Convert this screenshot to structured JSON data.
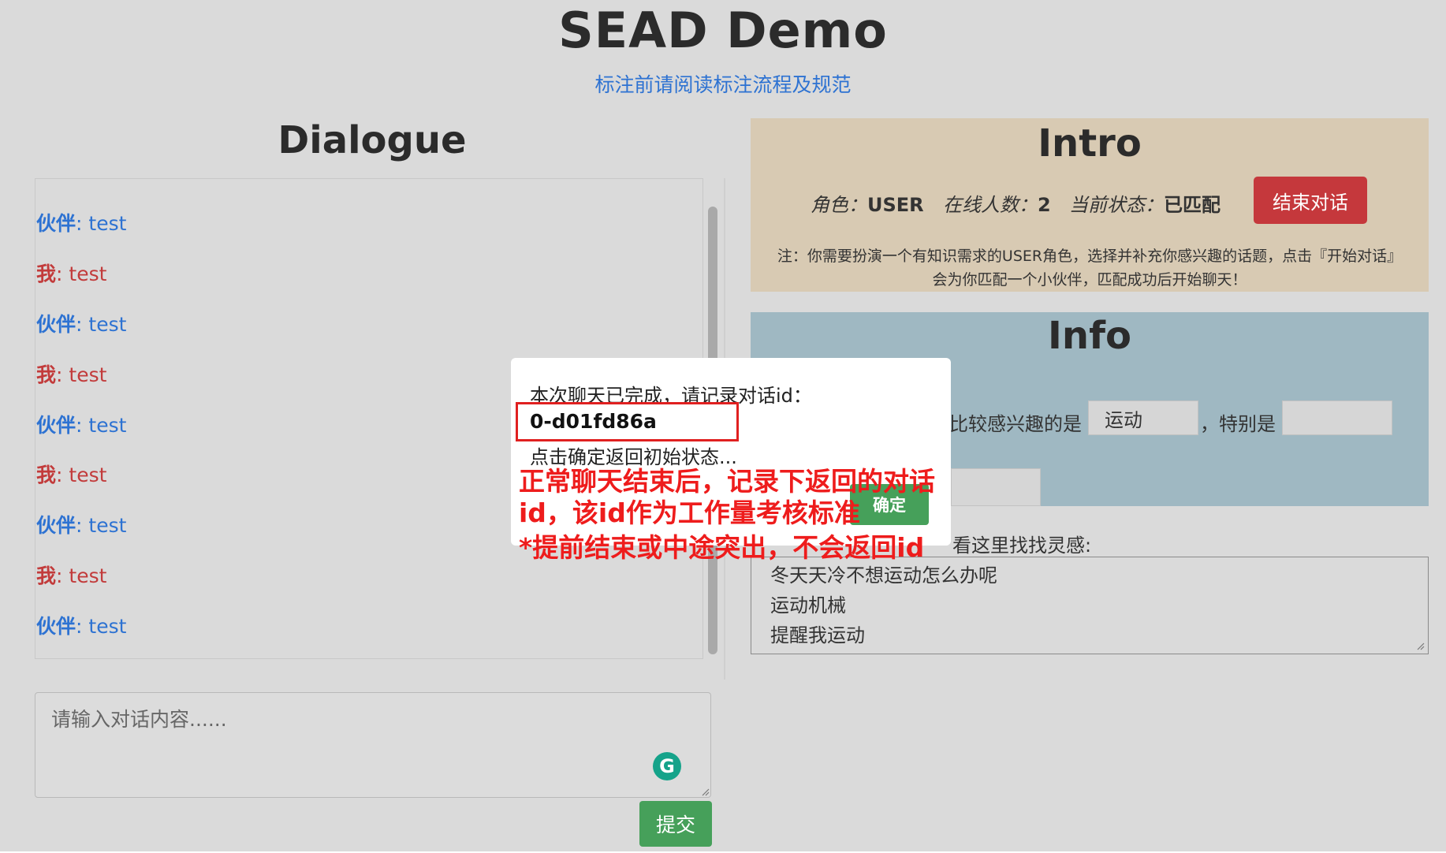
{
  "header": {
    "title": "SEAD Demo",
    "subtitle_link": "标注前请阅读标注流程及规范"
  },
  "dialogue": {
    "title": "Dialogue",
    "messages": [
      {
        "speaker": "伙伴",
        "text": ": test"
      },
      {
        "speaker": "我",
        "text": ": test"
      },
      {
        "speaker": "伙伴",
        "text": ": test"
      },
      {
        "speaker": "我",
        "text": ": test"
      },
      {
        "speaker": "伙伴",
        "text": ": test"
      },
      {
        "speaker": "我",
        "text": ": test"
      },
      {
        "speaker": "伙伴",
        "text": ": test"
      },
      {
        "speaker": "我",
        "text": ": test"
      },
      {
        "speaker": "伙伴",
        "text": ": test"
      }
    ],
    "input_placeholder": "请输入对话内容......",
    "grammarly_letter": "G",
    "submit_label": "提交"
  },
  "intro": {
    "title": "Intro",
    "role_label": "角色：",
    "role_value": "USER",
    "online_label": "在线人数：",
    "online_value": "2",
    "state_label": "当前状态：",
    "state_value": "已匹配",
    "end_button": "结束对话",
    "note_line1": "注：你需要扮演一个有知识需求的USER角色，选择并补充你感兴趣的话题，点击『开始对话』",
    "note_line2": "会为你匹配一个小伙伴，匹配成功后开始聊天！"
  },
  "info": {
    "title": "Info",
    "interest_text": "比较感兴趣的是",
    "topic_value": "运动",
    "special_text": "，特别是",
    "special_value": ""
  },
  "hints": {
    "label": "看这里找找灵感:",
    "items": [
      "冬天天冷不想运动怎么办呢",
      "运动机械",
      "提醒我运动"
    ]
  },
  "modal": {
    "line1": "本次聊天已完成，请记录对话id：",
    "dialog_id": "0-d01fd86a",
    "line3": "点击确定返回初始状态...",
    "confirm_button": "确定"
  },
  "annotation": {
    "line1": "正常聊天结束后，记录下返回的对话",
    "line2": "id，该id作为工作量考核标准",
    "line3": "*提前结束或中途突出，不会返回id"
  },
  "colors": {
    "partner": "#2d72d2",
    "me": "#c23b3b",
    "intro_bg": "#d8cab3",
    "info_bg": "#9fb8c2",
    "end_button": "#c5383c",
    "submit_button": "#46a05a",
    "annotation": "#ee1c1c"
  }
}
